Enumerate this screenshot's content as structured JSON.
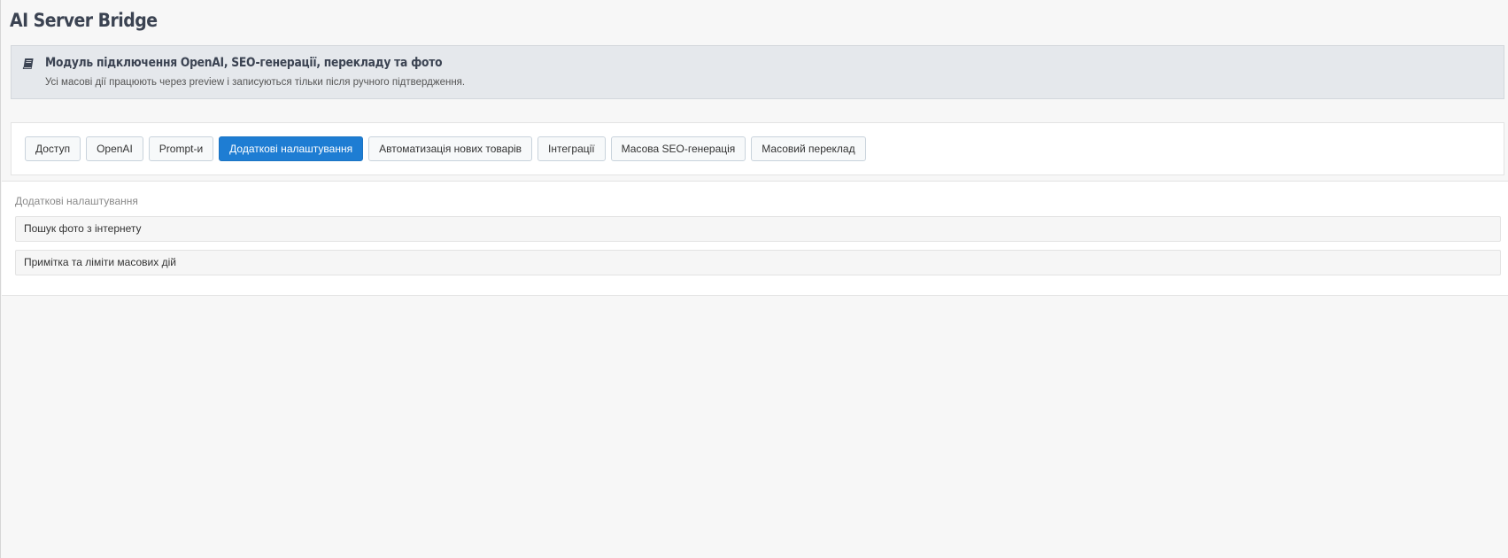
{
  "page": {
    "title": "AI Server Bridge"
  },
  "alert": {
    "icon": "book-icon",
    "title": "Модуль підключення OpenAI, SEO-генерації, перекладу та фото",
    "text": "Усі масові дії працюють через preview і записуються тільки після ручного підтвердження."
  },
  "tabs": [
    {
      "label": "Доступ",
      "active": false
    },
    {
      "label": "OpenAI",
      "active": false
    },
    {
      "label": "Prompt-и",
      "active": false
    },
    {
      "label": "Додаткові налаштування",
      "active": true
    },
    {
      "label": "Автоматизація нових товарів",
      "active": false
    },
    {
      "label": "Інтеграції",
      "active": false
    },
    {
      "label": "Масова SEO-генерація",
      "active": false
    },
    {
      "label": "Масовий переклад",
      "active": false
    }
  ],
  "section": {
    "title": "Додаткові налаштування",
    "items": [
      {
        "label": "Пошук фото з інтернету"
      },
      {
        "label": "Примітка та ліміти масових дій"
      }
    ]
  },
  "colors": {
    "accent": "#1e7dd3",
    "alert_bg": "#e5e8ec",
    "page_bg": "#f7f7f7"
  }
}
